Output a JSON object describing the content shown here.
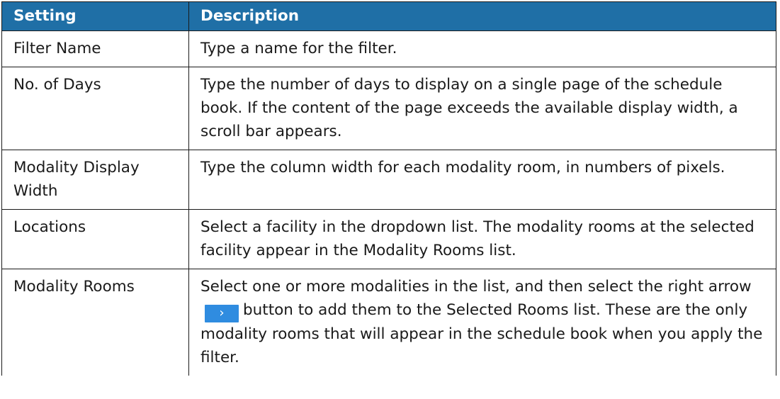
{
  "table": {
    "headers": {
      "setting": "Setting",
      "description": "Description"
    },
    "rows": [
      {
        "setting": "Filter Name",
        "description": "Type a name for the filter."
      },
      {
        "setting": "No. of Days",
        "description": "Type the number of days to display on a single page of the schedule book. If the content of the page exceeds the available display width, a scroll bar appears."
      },
      {
        "setting": "Modality Display Width",
        "description": "Type the column width for each modality room, in numbers of pixels."
      },
      {
        "setting": "Locations",
        "description": "Select a facility in the dropdown list. The modality rooms at the selected facility appear in the Modality Rooms list."
      },
      {
        "setting": "Modality Rooms",
        "description_before": "Select one or more modalities in the list, and then select the right arrow",
        "description_after": "button to add them to the Selected Rooms list. These are the only modality rooms that will appear in the schedule book when you apply the filter.",
        "button_icon": "chevron-right-icon",
        "button_glyph": "›"
      }
    ]
  },
  "colors": {
    "header_background": "#1f6fa6",
    "header_text": "#ffffff",
    "border": "#1a1a1a",
    "arrow_button": "#2f8ce0"
  }
}
